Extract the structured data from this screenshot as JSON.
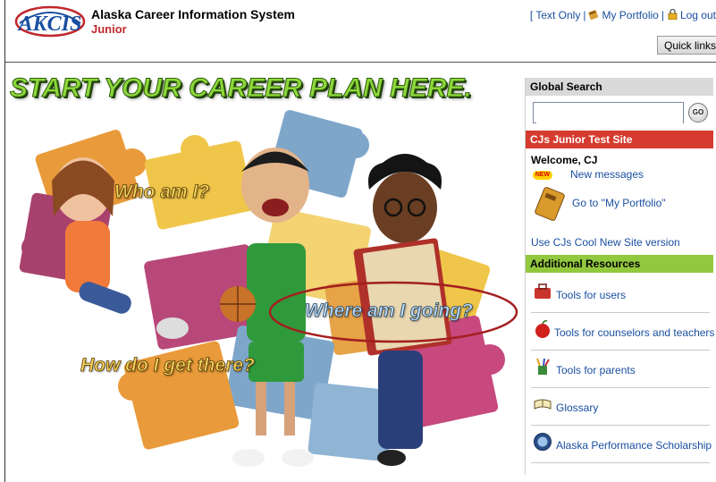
{
  "header": {
    "app_title": "Alaska Career Information System",
    "app_subtitle": "Junior",
    "logo_text": "AKCIS",
    "text_only": "[ Text Only",
    "separator": "|",
    "my_portfolio": "My Portfolio",
    "log_out": "Log out",
    "quick_links": "Quick links"
  },
  "hero": {
    "title": "START YOUR CAREER PLAN HERE.",
    "q1": "Who am I?",
    "q2": "Where am I going?",
    "q3": "How do I get there?"
  },
  "panel": {
    "search_header": "Global Search",
    "search_value": "",
    "go_label": "GO",
    "site_header": "CJs Junior Test Site",
    "welcome": "Welcome, CJ",
    "new_badge": "NEW",
    "new_messages": "New messages",
    "go_portfolio": "Go to \"My Portfolio\"",
    "cool_site": "Use CJs Cool New Site version",
    "resources_header": "Additional Resources",
    "resources": [
      {
        "label": "Tools for users",
        "icon": "toolbox-icon"
      },
      {
        "label": "Tools for counselors and teachers",
        "icon": "apple-icon"
      },
      {
        "label": "Tools for parents",
        "icon": "pencil-cup-icon"
      },
      {
        "label": "Glossary",
        "icon": "book-icon"
      },
      {
        "label": "Alaska Performance Scholarship",
        "icon": "seal-icon"
      }
    ]
  },
  "colors": {
    "link": "#1a4fa0",
    "site_header": "#d53c2f",
    "resources_header": "#92c83e",
    "search_header": "#d9d9d9",
    "title_green": "#8ed93a"
  }
}
